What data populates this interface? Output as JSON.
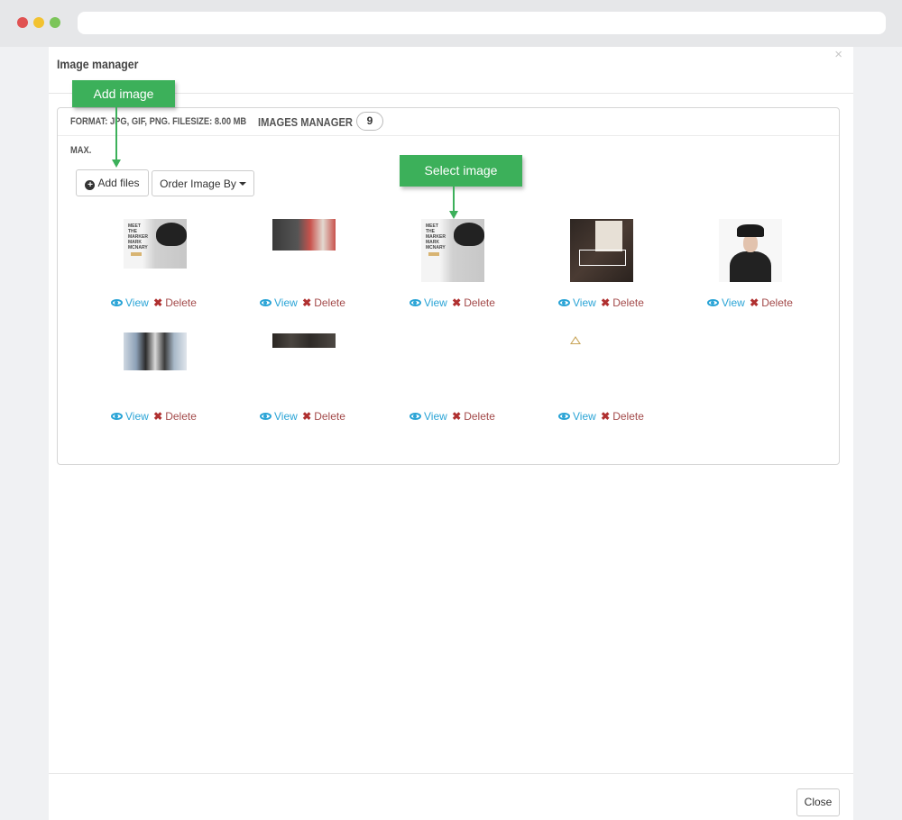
{
  "modal": {
    "title": "Image manager",
    "close_symbol": "×",
    "format_text": "FORMAT: JPG, GIF, PNG. FILESIZE: 8.00 MB",
    "max_text": "MAX.",
    "manager_label": "IMAGES MANAGER",
    "image_count": "9",
    "add_files_label": "Add files",
    "order_label": "Order Image By",
    "footer_close_label": "Close"
  },
  "callouts": {
    "add_image": "Add image",
    "select_image": "Select image"
  },
  "images": [
    {
      "view_label": "View",
      "delete_label": "Delete",
      "thumbnail": "man-hat-back"
    },
    {
      "view_label": "View",
      "delete_label": "Delete",
      "thumbnail": "magazine"
    },
    {
      "view_label": "View",
      "delete_label": "Delete",
      "thumbnail": "man-hat-back"
    },
    {
      "view_label": "View",
      "delete_label": "Delete",
      "thumbnail": "magazine-table"
    },
    {
      "view_label": "View",
      "delete_label": "Delete",
      "thumbnail": "man-portrait"
    },
    {
      "view_label": "View",
      "delete_label": "Delete",
      "thumbnail": "group-photo"
    },
    {
      "view_label": "View",
      "delete_label": "Delete",
      "thumbnail": "dark-strip"
    },
    {
      "view_label": "View",
      "delete_label": "Delete",
      "thumbnail": "empty"
    },
    {
      "view_label": "View",
      "delete_label": "Delete",
      "thumbnail": "broken-image"
    }
  ],
  "thumbnail_text": {
    "marker_line1": "MEET",
    "marker_line2": "THE",
    "marker_line3": "MARKER",
    "marker_line4": "MARK",
    "marker_line5": "MCNARY"
  },
  "colors": {
    "callout": "#3cb05a",
    "view": "#2aa4d6",
    "delete": "#a34a4a"
  }
}
